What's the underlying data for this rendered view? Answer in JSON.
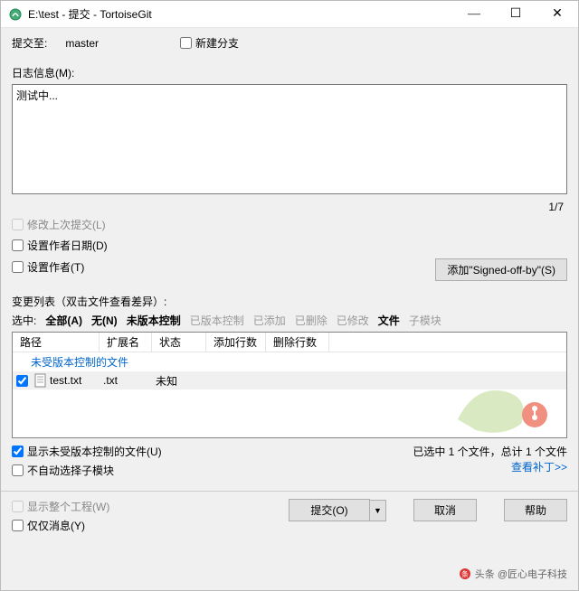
{
  "titlebar": {
    "title": "E:\\test - 提交 - TortoiseGit"
  },
  "commit_to": {
    "label": "提交至:",
    "branch": "master"
  },
  "new_branch": {
    "label": "新建分支"
  },
  "log_label": "日志信息(M):",
  "log_message": "测试中...",
  "counter": "1/7",
  "amend": {
    "label": "修改上次提交(L)"
  },
  "set_author_date": {
    "label": "设置作者日期(D)"
  },
  "set_author": {
    "label": "设置作者(T)"
  },
  "signoff": {
    "label": "添加\"Signed-off-by\"(S)"
  },
  "changelist_label": "变更列表（双击文件查看差异）:",
  "filter": {
    "sel": "选中:",
    "all": "全部(A)",
    "none": "无(N)",
    "unversioned": "未版本控制",
    "versioned": "已版本控制",
    "added": "已添加",
    "deleted": "已删除",
    "modified": "已修改",
    "files": "文件",
    "submodule": "子模块"
  },
  "columns": {
    "path": "路径",
    "ext": "扩展名",
    "status": "状态",
    "add": "添加行数",
    "del": "删除行数"
  },
  "group_row": "未受版本控制的文件",
  "file_row": {
    "name": "test.txt",
    "ext": ".txt",
    "status": "未知"
  },
  "summary": "已选中 1 个文件，总计 1 个文件",
  "show_unversioned": {
    "label": "显示未受版本控制的文件(U)"
  },
  "no_autoselect_submodule": {
    "label": "不自动选择子模块"
  },
  "view_patch": "查看补丁>>",
  "show_whole": {
    "label": "显示整个工程(W)"
  },
  "only_message": {
    "label": "仅仅消息(Y)"
  },
  "buttons": {
    "commit": "提交(O)",
    "cancel": "取消",
    "help": "帮助"
  },
  "credit": "头条 @匠心电子科技"
}
